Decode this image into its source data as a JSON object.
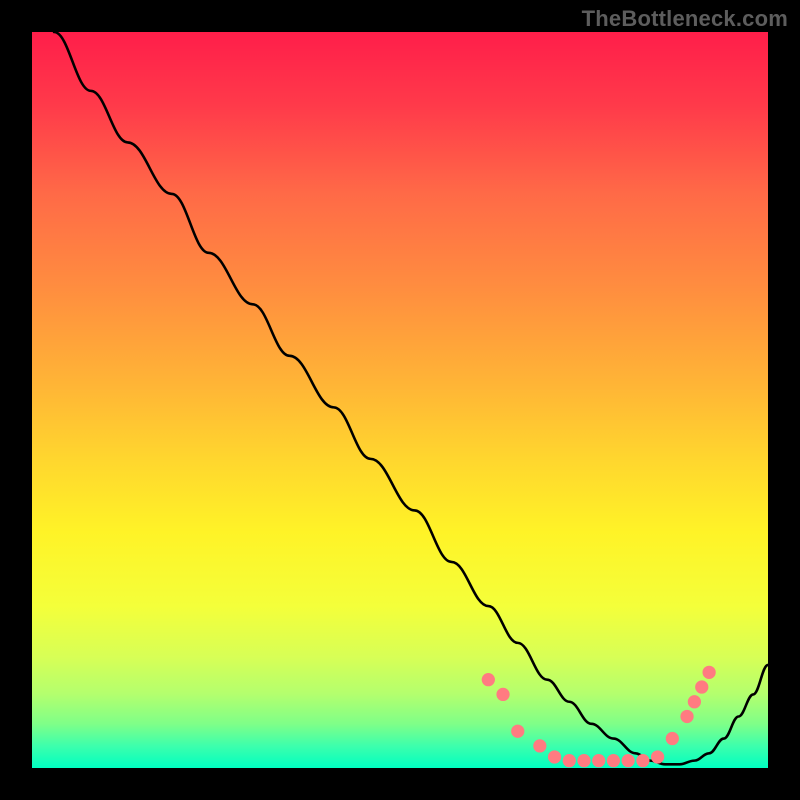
{
  "watermark": "TheBottleneck.com",
  "chart_data": {
    "type": "line",
    "title": "",
    "xlabel": "",
    "ylabel": "",
    "xlim": [
      0,
      100
    ],
    "ylim": [
      0,
      100
    ],
    "series": [
      {
        "name": "curve",
        "x": [
          3,
          8,
          13,
          19,
          24,
          30,
          35,
          41,
          46,
          52,
          57,
          62,
          66,
          70,
          73,
          76,
          79,
          82,
          84,
          86,
          88,
          90,
          92,
          94,
          96,
          98,
          100
        ],
        "y": [
          100,
          92,
          85,
          78,
          70,
          63,
          56,
          49,
          42,
          35,
          28,
          22,
          17,
          12,
          9,
          6,
          4,
          2,
          1,
          0.5,
          0.5,
          1,
          2,
          4,
          7,
          10,
          14
        ]
      },
      {
        "name": "dots",
        "x": [
          62,
          64,
          66,
          69,
          71,
          73,
          75,
          77,
          79,
          81,
          83,
          85,
          87,
          89,
          90,
          91,
          92
        ],
        "y": [
          12,
          10,
          5,
          3,
          1.5,
          1,
          1,
          1,
          1,
          1,
          1,
          1.5,
          4,
          7,
          9,
          11,
          13
        ]
      }
    ],
    "gradient_stops": [
      {
        "offset": 0.0,
        "color": "#ff1e4a"
      },
      {
        "offset": 0.1,
        "color": "#ff3a4a"
      },
      {
        "offset": 0.22,
        "color": "#ff6a47"
      },
      {
        "offset": 0.35,
        "color": "#ff8e3f"
      },
      {
        "offset": 0.48,
        "color": "#ffb536"
      },
      {
        "offset": 0.58,
        "color": "#ffd62e"
      },
      {
        "offset": 0.68,
        "color": "#fff327"
      },
      {
        "offset": 0.78,
        "color": "#f4ff3a"
      },
      {
        "offset": 0.85,
        "color": "#d7ff56"
      },
      {
        "offset": 0.9,
        "color": "#b3ff6e"
      },
      {
        "offset": 0.94,
        "color": "#7fff88"
      },
      {
        "offset": 0.97,
        "color": "#3dffac"
      },
      {
        "offset": 1.0,
        "color": "#00ffc1"
      }
    ],
    "dot_color": "#ff7b81",
    "curve_color": "#000000"
  }
}
